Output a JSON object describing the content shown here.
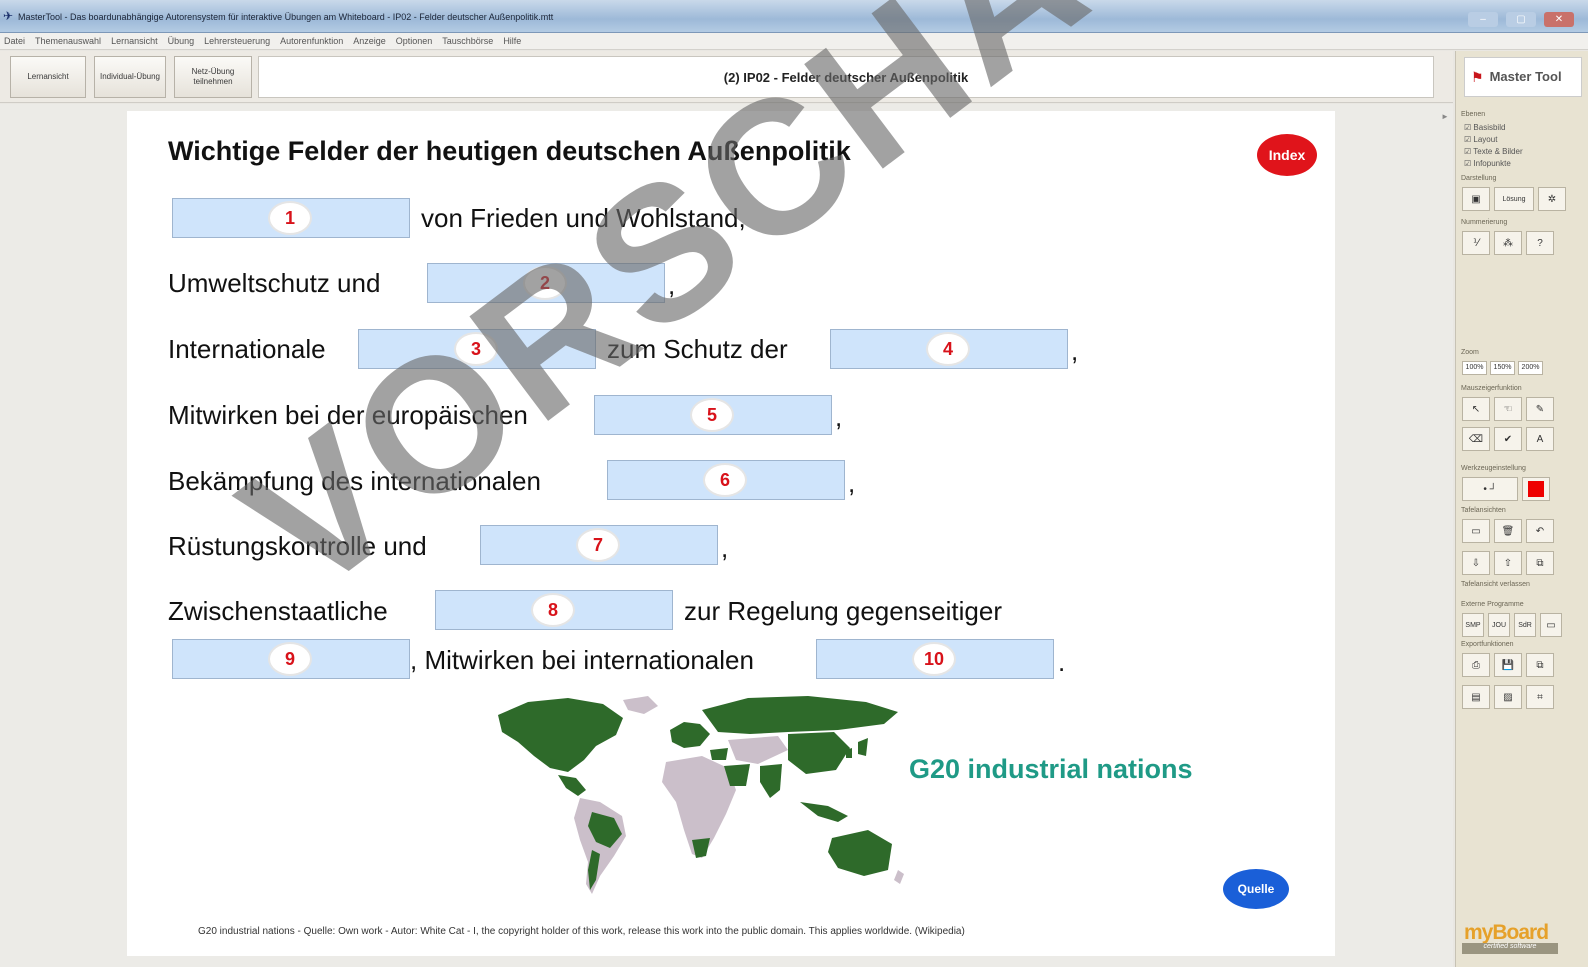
{
  "window": {
    "title": "MasterTool - Das boardunabhängige Autorensystem für interaktive Übungen am Whiteboard - IP02 - Felder deutscher Außenpolitik.mtt",
    "buttons": [
      "–",
      "▢",
      "✕"
    ]
  },
  "menu": [
    "Datei",
    "Themenauswahl",
    "Lernansicht",
    "Übung",
    "Lehrersteuerung",
    "Autorenfunktion",
    "Anzeige",
    "Optionen",
    "Tauschbörse",
    "Hilfe"
  ],
  "toolbar": {
    "lernansicht": "Lernansicht",
    "individual": "Individual-Übung",
    "netz": "Netz-Übung teilnehmen",
    "doc_title": "(2) IP02 - Felder deutscher Außenpolitik"
  },
  "exercise": {
    "heading": "Wichtige Felder der heutigen deutschen Außenpolitik",
    "index_label": "Index",
    "line1_text": "von Frieden und Wohlstand,",
    "line2_text": "Umweltschutz und",
    "line2_end": ",",
    "line3_text_a": "Internationale",
    "line3_text_b": "zum Schutz der",
    "line3_end": ",",
    "line4_text": "Mitwirken bei der europäischen",
    "line4_end": ",",
    "line5_text": "Bekämpfung des internationalen",
    "line5_end": ",",
    "line6_text": "Rüstungskontrolle und",
    "line6_end": ",",
    "line7_text_a": "Zwischenstaatliche",
    "line7_text_b": "zur Regelung gegenseitiger",
    "line8_text": ", Mitwirken bei internationalen",
    "line8_end": ".",
    "blank_numbers": [
      "1",
      "2",
      "3",
      "4",
      "5",
      "6",
      "7",
      "8",
      "9",
      "10"
    ],
    "map_caption": "G20 industrial nations",
    "quelle_label": "Quelle",
    "footnote": "G20 industrial nations  -  Quelle: Own work  -  Autor: White Cat  -  I, the copyright holder of this work, release this work into the public domain. This applies worldwide. (Wikipedia)",
    "watermark": "VORSCHAU"
  },
  "sidebar": {
    "ebenen": "Ebenen",
    "checks": [
      "Basisbild",
      "Layout",
      "Texte & Bilder",
      "Infopunkte"
    ],
    "darstellung": "Darstellung",
    "loesung": "Lösung",
    "nummerierung": "Nummerierung",
    "zoom": "Zoom",
    "zoom_levels": [
      "100%",
      "150%",
      "200%"
    ],
    "mauszeiger": "Mauszeigerfunktion",
    "werkzeug": "Werkzeugeinstellung",
    "tafelansichten": "Tafelansichten",
    "tafelansicht_verlassen": "Tafelansicht verlassen",
    "externe": "Externe Programme",
    "ext_buttons": [
      "SMP",
      "JOU",
      "SdR"
    ],
    "exportfunktionen": "Exportfunktionen",
    "logo_text": "Master Tool",
    "myboard": "myBoard",
    "certified": "certified software"
  },
  "colors": {
    "blank_fill": "#cfe4fb",
    "number_red": "#d8121a",
    "index_red": "#e0141b",
    "quelle_blue": "#1a5fd8",
    "g20_teal": "#1f9a86",
    "map_green": "#2e6a2a",
    "map_gray": "#cbbfca"
  }
}
